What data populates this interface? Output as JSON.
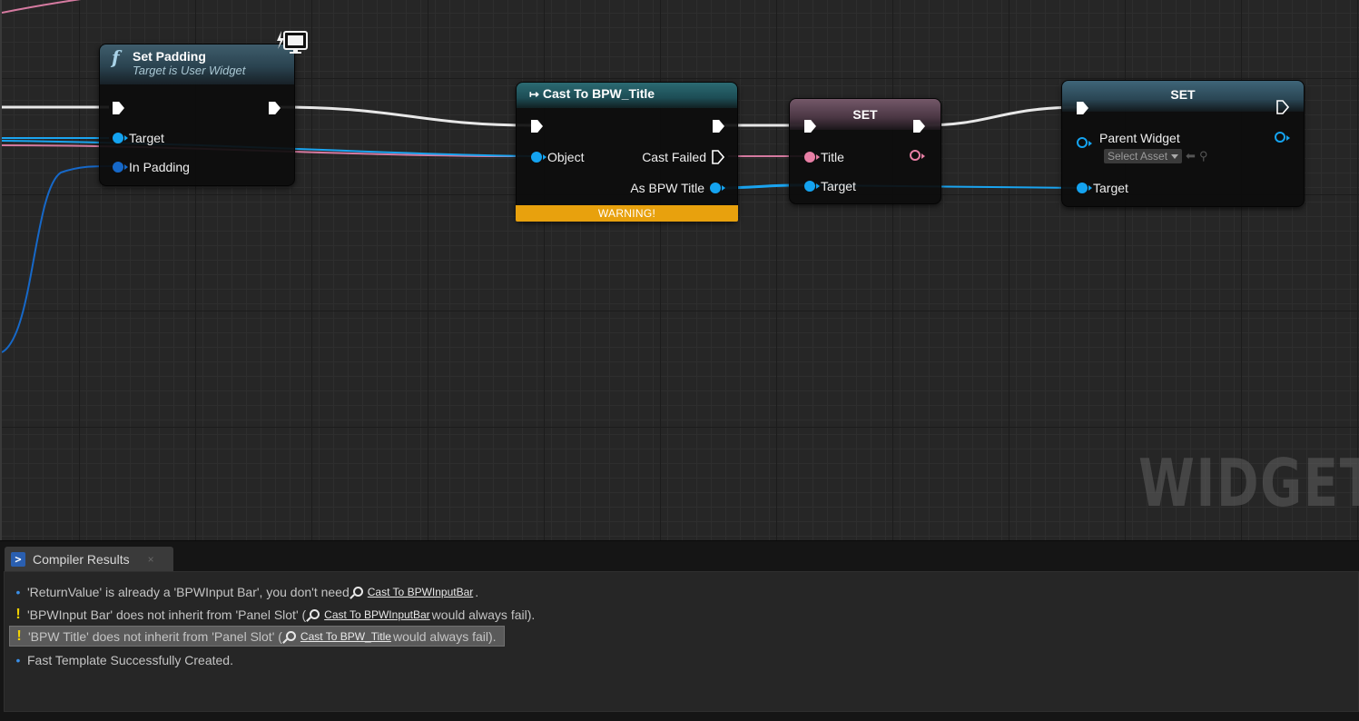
{
  "graph": {
    "watermark": "WIDGET",
    "nodes": {
      "set_padding": {
        "title": "Set Padding",
        "subtitle": "Target is User Widget",
        "pins": {
          "target": "Target",
          "in_padding": "In Padding"
        }
      },
      "cast": {
        "title": "Cast To BPW_Title",
        "pins": {
          "object": "Object",
          "cast_failed": "Cast Failed",
          "as_bpw_title": "As BPW Title"
        },
        "warning": "WARNING!"
      },
      "set_title": {
        "title": "SET",
        "pins": {
          "title": "Title",
          "target": "Target"
        }
      },
      "set_parent": {
        "title": "SET",
        "pins": {
          "parent_widget": "Parent Widget",
          "target": "Target"
        },
        "select_asset": "Select Asset"
      }
    }
  },
  "compiler_results": {
    "tab_label": "Compiler Results",
    "tab_close": "×",
    "messages": [
      {
        "type": "info",
        "pre": "'ReturnValue' is already a 'BPWInput Bar', you don't need ",
        "link": "Cast To BPWInputBar",
        "post": " ."
      },
      {
        "type": "warning",
        "pre": "'BPWInput Bar' does not inherit from 'Panel Slot' (",
        "link": "Cast To BPWInputBar",
        "post": " would always fail)."
      },
      {
        "type": "warning",
        "pre": "'BPW Title' does not inherit from 'Panel Slot' (",
        "link": "Cast To BPW_Title",
        "post": " would always fail).",
        "selected": true
      },
      {
        "type": "info",
        "pre": "Fast Template Successfully Created."
      }
    ]
  }
}
